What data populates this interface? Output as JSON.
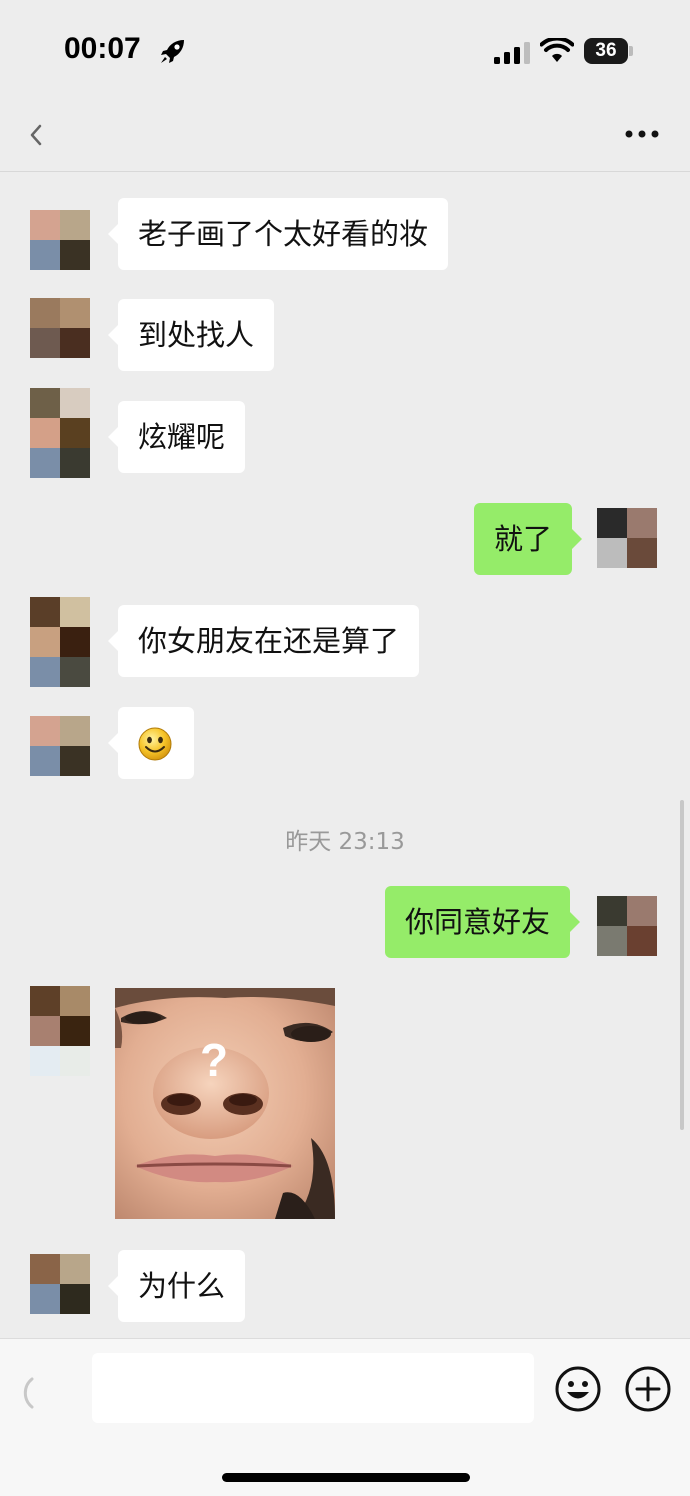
{
  "status_bar": {
    "time": "00:07",
    "rocket_icon": "rocket-icon",
    "signal_icon": "signal-bars-icon",
    "wifi_icon": "wifi-icon",
    "battery_level": "36"
  },
  "nav": {
    "back_icon": "chevron-left-icon",
    "more_icon": "more-dots-icon"
  },
  "messages": [
    {
      "side": "left",
      "type": "text",
      "text": "老子画了个太好看的妆",
      "avatar_colors": [
        "#d4a390",
        "#b8a68a",
        "#7a8ea8",
        "#3a3224"
      ]
    },
    {
      "side": "left",
      "type": "text",
      "text": "到处找人",
      "avatar_colors": [
        "#9a7a5e",
        "#b09070",
        "#6e5a50",
        "#4a2e20"
      ]
    },
    {
      "side": "left",
      "type": "text",
      "text": "炫耀呢",
      "avatar_colors": [
        "#6e6048",
        "#d8ccc0",
        "#d4a088",
        "#5a4020"
      ]
    },
    {
      "side": "right",
      "type": "text",
      "text": "就了",
      "avatar_colors": [
        "#2a2a2a",
        "#9a7a6e",
        "#bcbcbc",
        "#6a4a3a"
      ]
    },
    {
      "side": "left",
      "type": "text",
      "text": "你女朋友在还是算了",
      "avatar_colors": [
        "#5a3e28",
        "#d0c0a0",
        "#c8a080",
        "#3a2010"
      ]
    },
    {
      "side": "left",
      "type": "emoji",
      "emoji": "smiley-face-emoji",
      "avatar_colors": [
        "#d4a390",
        "#b8a68a",
        "#7a8ea8",
        "#3a3224"
      ]
    },
    {
      "side": "right",
      "type": "text",
      "text": "你同意好友",
      "avatar_colors": [
        "#3a3a30",
        "#9a7a6e",
        "#7a7a70",
        "#6a4030"
      ]
    },
    {
      "side": "left",
      "type": "image",
      "image": "photo-face-closeup",
      "overlay_text": "?",
      "avatar_colors": [
        "#5e4028",
        "#a88a68",
        "#a88070",
        "#3a2410"
      ]
    },
    {
      "side": "left",
      "type": "text",
      "text": "为什么",
      "avatar_colors": [
        "#8a6448",
        "#b8a68a",
        "#7a8ea8",
        "#2e2a1e"
      ]
    }
  ],
  "timestamp": "昨天 23:13",
  "input_bar": {
    "voice_icon": "voice-icon",
    "input_value": "",
    "emoji_icon": "emoji-smile-icon",
    "plus_icon": "plus-circle-icon"
  },
  "colors": {
    "background": "#ededed",
    "bubble_self": "#95ec69",
    "bubble_other": "#ffffff",
    "timestamp": "#999999"
  }
}
